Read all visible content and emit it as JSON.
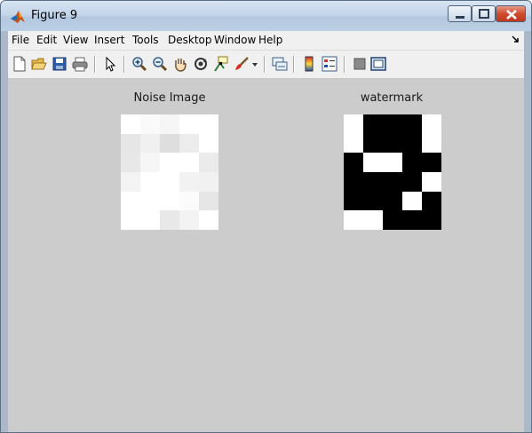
{
  "window": {
    "title": "Figure 9",
    "controls": [
      "minimize-button",
      "maximize-button",
      "close-button"
    ]
  },
  "menubar": {
    "items": [
      {
        "label": "File"
      },
      {
        "label": "Edit"
      },
      {
        "label": "View"
      },
      {
        "label": "Insert"
      },
      {
        "label": "Tools"
      },
      {
        "label": "Desktop"
      },
      {
        "label": "Window"
      },
      {
        "label": "Help"
      }
    ]
  },
  "toolbar": {
    "icons": [
      "new-figure-icon",
      "open-file-icon",
      "save-icon",
      "print-icon",
      "select-arrow-icon",
      "zoom-in-icon",
      "zoom-out-icon",
      "pan-hand-icon",
      "rotate-3d-icon",
      "data-cursor-icon",
      "brush-icon",
      "brush-dropdown-icon",
      "link-plot-icon",
      "insert-colorbar-icon",
      "insert-legend-icon",
      "hide-plot-tools-icon",
      "show-plot-tools-icon"
    ]
  },
  "axes": [
    {
      "title": "Noise Image",
      "grid": [
        [
          "#ffffff",
          "#fafafa",
          "#f6f6f6",
          "#ffffff",
          "#ffffff"
        ],
        [
          "#e6e6e6",
          "#f0f0f0",
          "#dedede",
          "#ececec",
          "#ffffff"
        ],
        [
          "#e8e8e8",
          "#f6f6f6",
          "#ffffff",
          "#ffffff",
          "#ebebeb"
        ],
        [
          "#f3f3f3",
          "#ffffff",
          "#ffffff",
          "#f2f2f2",
          "#f1f1f1"
        ],
        [
          "#ffffff",
          "#ffffff",
          "#ffffff",
          "#fbfbfb",
          "#e6e6e6"
        ],
        [
          "#ffffff",
          "#ffffff",
          "#e8e8e8",
          "#f3f3f3",
          "#ffffff"
        ]
      ]
    },
    {
      "title": "watermark",
      "grid": [
        [
          "#ffffff",
          "#000000",
          "#000000",
          "#000000",
          "#ffffff"
        ],
        [
          "#ffffff",
          "#000000",
          "#000000",
          "#000000",
          "#ffffff"
        ],
        [
          "#000000",
          "#ffffff",
          "#ffffff",
          "#000000",
          "#000000"
        ],
        [
          "#000000",
          "#000000",
          "#000000",
          "#000000",
          "#ffffff"
        ],
        [
          "#000000",
          "#000000",
          "#000000",
          "#ffffff",
          "#000000"
        ],
        [
          "#ffffff",
          "#ffffff",
          "#000000",
          "#000000",
          "#000000"
        ]
      ]
    }
  ]
}
